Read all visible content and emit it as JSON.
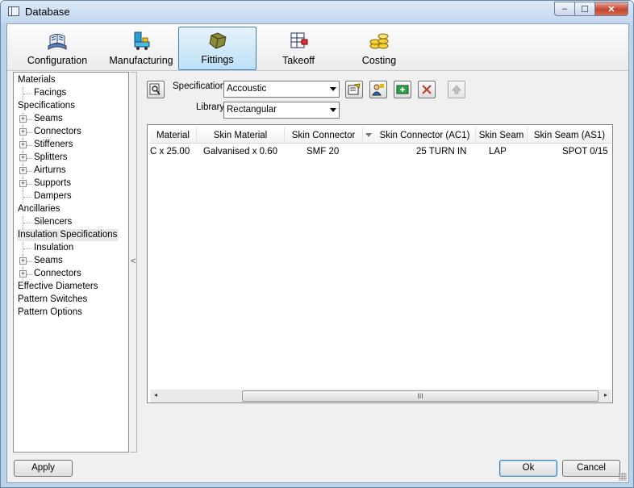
{
  "window": {
    "title": "Database",
    "min": "‒",
    "max": "☐",
    "close": "✕"
  },
  "ribbon": {
    "tabs": [
      {
        "label": "Configuration",
        "icon": "books-icon"
      },
      {
        "label": "Manufacturing",
        "icon": "machine-icon"
      },
      {
        "label": "Fittings",
        "icon": "fittings-icon"
      },
      {
        "label": "Takeoff",
        "icon": "takeoff-icon"
      },
      {
        "label": "Costing",
        "icon": "coins-icon"
      }
    ],
    "selected": "Fittings"
  },
  "tree": {
    "items": [
      {
        "label": "Materials"
      },
      {
        "label": "Facings"
      },
      {
        "label": "Specifications"
      },
      {
        "label": "Seams"
      },
      {
        "label": "Connectors"
      },
      {
        "label": "Stiffeners"
      },
      {
        "label": "Splitters"
      },
      {
        "label": "Airturns"
      },
      {
        "label": "Supports"
      },
      {
        "label": "Dampers"
      },
      {
        "label": "Ancillaries"
      },
      {
        "label": "Silencers"
      },
      {
        "label": "Insulation Specifications"
      },
      {
        "label": "Insulation"
      },
      {
        "label": "Seams"
      },
      {
        "label": "Connectors"
      },
      {
        "label": "Effective Diameters"
      },
      {
        "label": "Pattern Switches"
      },
      {
        "label": "Pattern Options"
      }
    ],
    "selected": "Insulation Specifications",
    "expand_glyph": "+"
  },
  "splitter": {
    "glyph": "<"
  },
  "form": {
    "specification_label": "Specification",
    "specification_value": "Accoustic",
    "library_label": "Library",
    "library_value": "Rectangular"
  },
  "grid": {
    "columns": [
      "Material",
      "Skin Material",
      "Skin Connector",
      "Skin Connector (AC1)",
      "Skin Seam",
      "Skin Seam (AS1)"
    ],
    "rows": [
      [
        "C x 25.00",
        "Galvanised x 0.60",
        "SMF 20",
        "25 TURN IN",
        "LAP",
        "SPOT 0/15"
      ]
    ],
    "scroll_left": "◂",
    "scroll_right": "▸",
    "thumb_grip": "III"
  },
  "buttons": {
    "apply": "Apply",
    "ok": "Ok",
    "cancel": "Cancel"
  },
  "colors": {
    "accent": "#3c7fb1",
    "delete": "#c0392b"
  }
}
